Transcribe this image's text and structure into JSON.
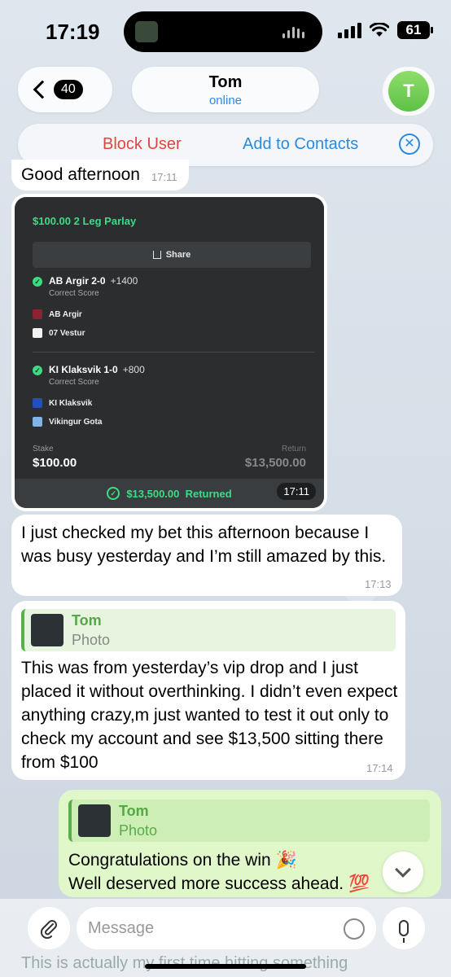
{
  "status": {
    "time": "17:19",
    "battery": "61"
  },
  "header": {
    "back_count": "40",
    "name": "Tom",
    "status": "online",
    "avatar_letter": "T"
  },
  "actions": {
    "block": "Block User",
    "add_contacts": "Add to Contacts"
  },
  "messages": {
    "m1": {
      "text": "Good afternoon",
      "time": "17:11"
    },
    "photo": {
      "time": "17:11",
      "bet_title": "$100.00 2 Leg Parlay",
      "share": "Share",
      "legs": [
        {
          "name": "AB Argir 2-0",
          "odds": "+1400",
          "type": "Correct Score",
          "team1": "AB Argir",
          "team2": "07 Vestur"
        },
        {
          "name": "KI Klaksvik 1-0",
          "odds": "+800",
          "type": "Correct Score",
          "team1": "KI Klaksvik",
          "team2": "Vikingur Gota"
        }
      ],
      "stake_label": "Stake",
      "stake_value": "$100.00",
      "return_label": "Return",
      "return_value": "$13,500.00",
      "returned": "$13,500.00  Returned"
    },
    "m2": {
      "text": "I just checked my bet this afternoon because I was busy yesterday and  I’m still amazed by this.",
      "time": "17:13"
    },
    "m3": {
      "reply_name": "Tom",
      "reply_sub": "Photo",
      "text": "This was from yesterday’s vip drop and I just placed it without overthinking. I didn’t even expect anything crazy,m just wanted to test it out only to check my account and see $13,500 sitting there from $100",
      "time": "17:14"
    },
    "m4": {
      "reply_name": "Tom",
      "reply_sub": "Photo",
      "text_line1": "Congratulations on the win 🎉",
      "text_line2": "Well deserved more success ahead. 💯"
    }
  },
  "input": {
    "placeholder": "Message",
    "peek": "This is actually my first time hitting something"
  },
  "colors": {
    "accent_blue": "#2a8ae0",
    "accent_red": "#e0453c",
    "accent_green": "#3ddc84",
    "bubble_out": "#e0f7c9"
  }
}
